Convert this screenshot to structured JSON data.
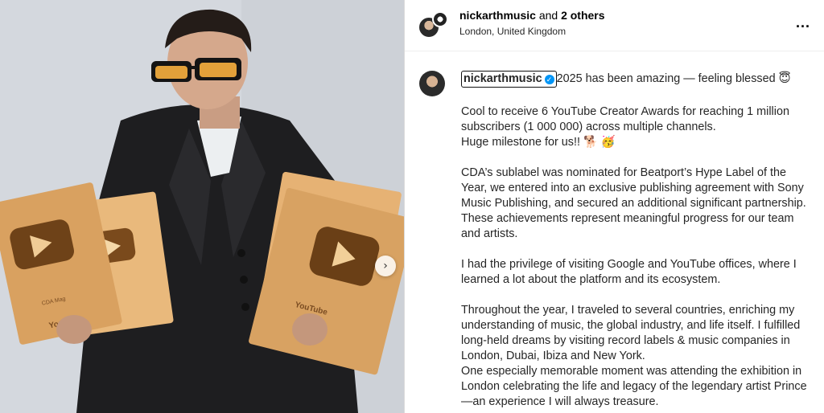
{
  "header": {
    "username": "nickarthmusic",
    "and_text": "and",
    "others": "2 others",
    "location": "London, United Kingdom",
    "more_icon": "..."
  },
  "caption": {
    "username": "nickarthmusic",
    "first_text": "2025 has been amazing — feeling blessed 😇",
    "paragraphs": [
      "Cool to receive 6 YouTube Creator Awards for reaching 1 million\nsubscribers (1 000 000) across multiple channels.\nHuge milestone for us!! 🐕 🥳",
      "CDA’s sublabel was nominated for Beatport’s Hype Label of the\nYear, we entered into an exclusive publishing agreement with Sony\nMusic Publishing, and secured an additional significant partnership.\nThese achievements represent meaningful progress for our team\nand artists.",
      "I had the privilege of visiting Google and YouTube offices, where I\nlearned a lot about the platform and its ecosystem.",
      "Throughout the year, I traveled to several countries, enriching my\nunderstanding of music, the global industry, and life itself. I fulfilled\nlong-held dreams by visiting record labels & music companies in\nLondon, Dubai, Ibiza and New York.\nOne especially memorable moment was attending the exhibition in\nLondon celebrating the life and legacy of the legendary artist Prince\n—an experience I will always treasure."
    ]
  },
  "photo": {
    "plaque_texts": [
      "CDA Mag",
      "YouTube",
      "YouTube"
    ],
    "next_icon": "chevron-right-icon"
  },
  "colors": {
    "verified": "#0095f6",
    "plaque": "#d9a86a",
    "jacket": "#1c1c1e"
  }
}
